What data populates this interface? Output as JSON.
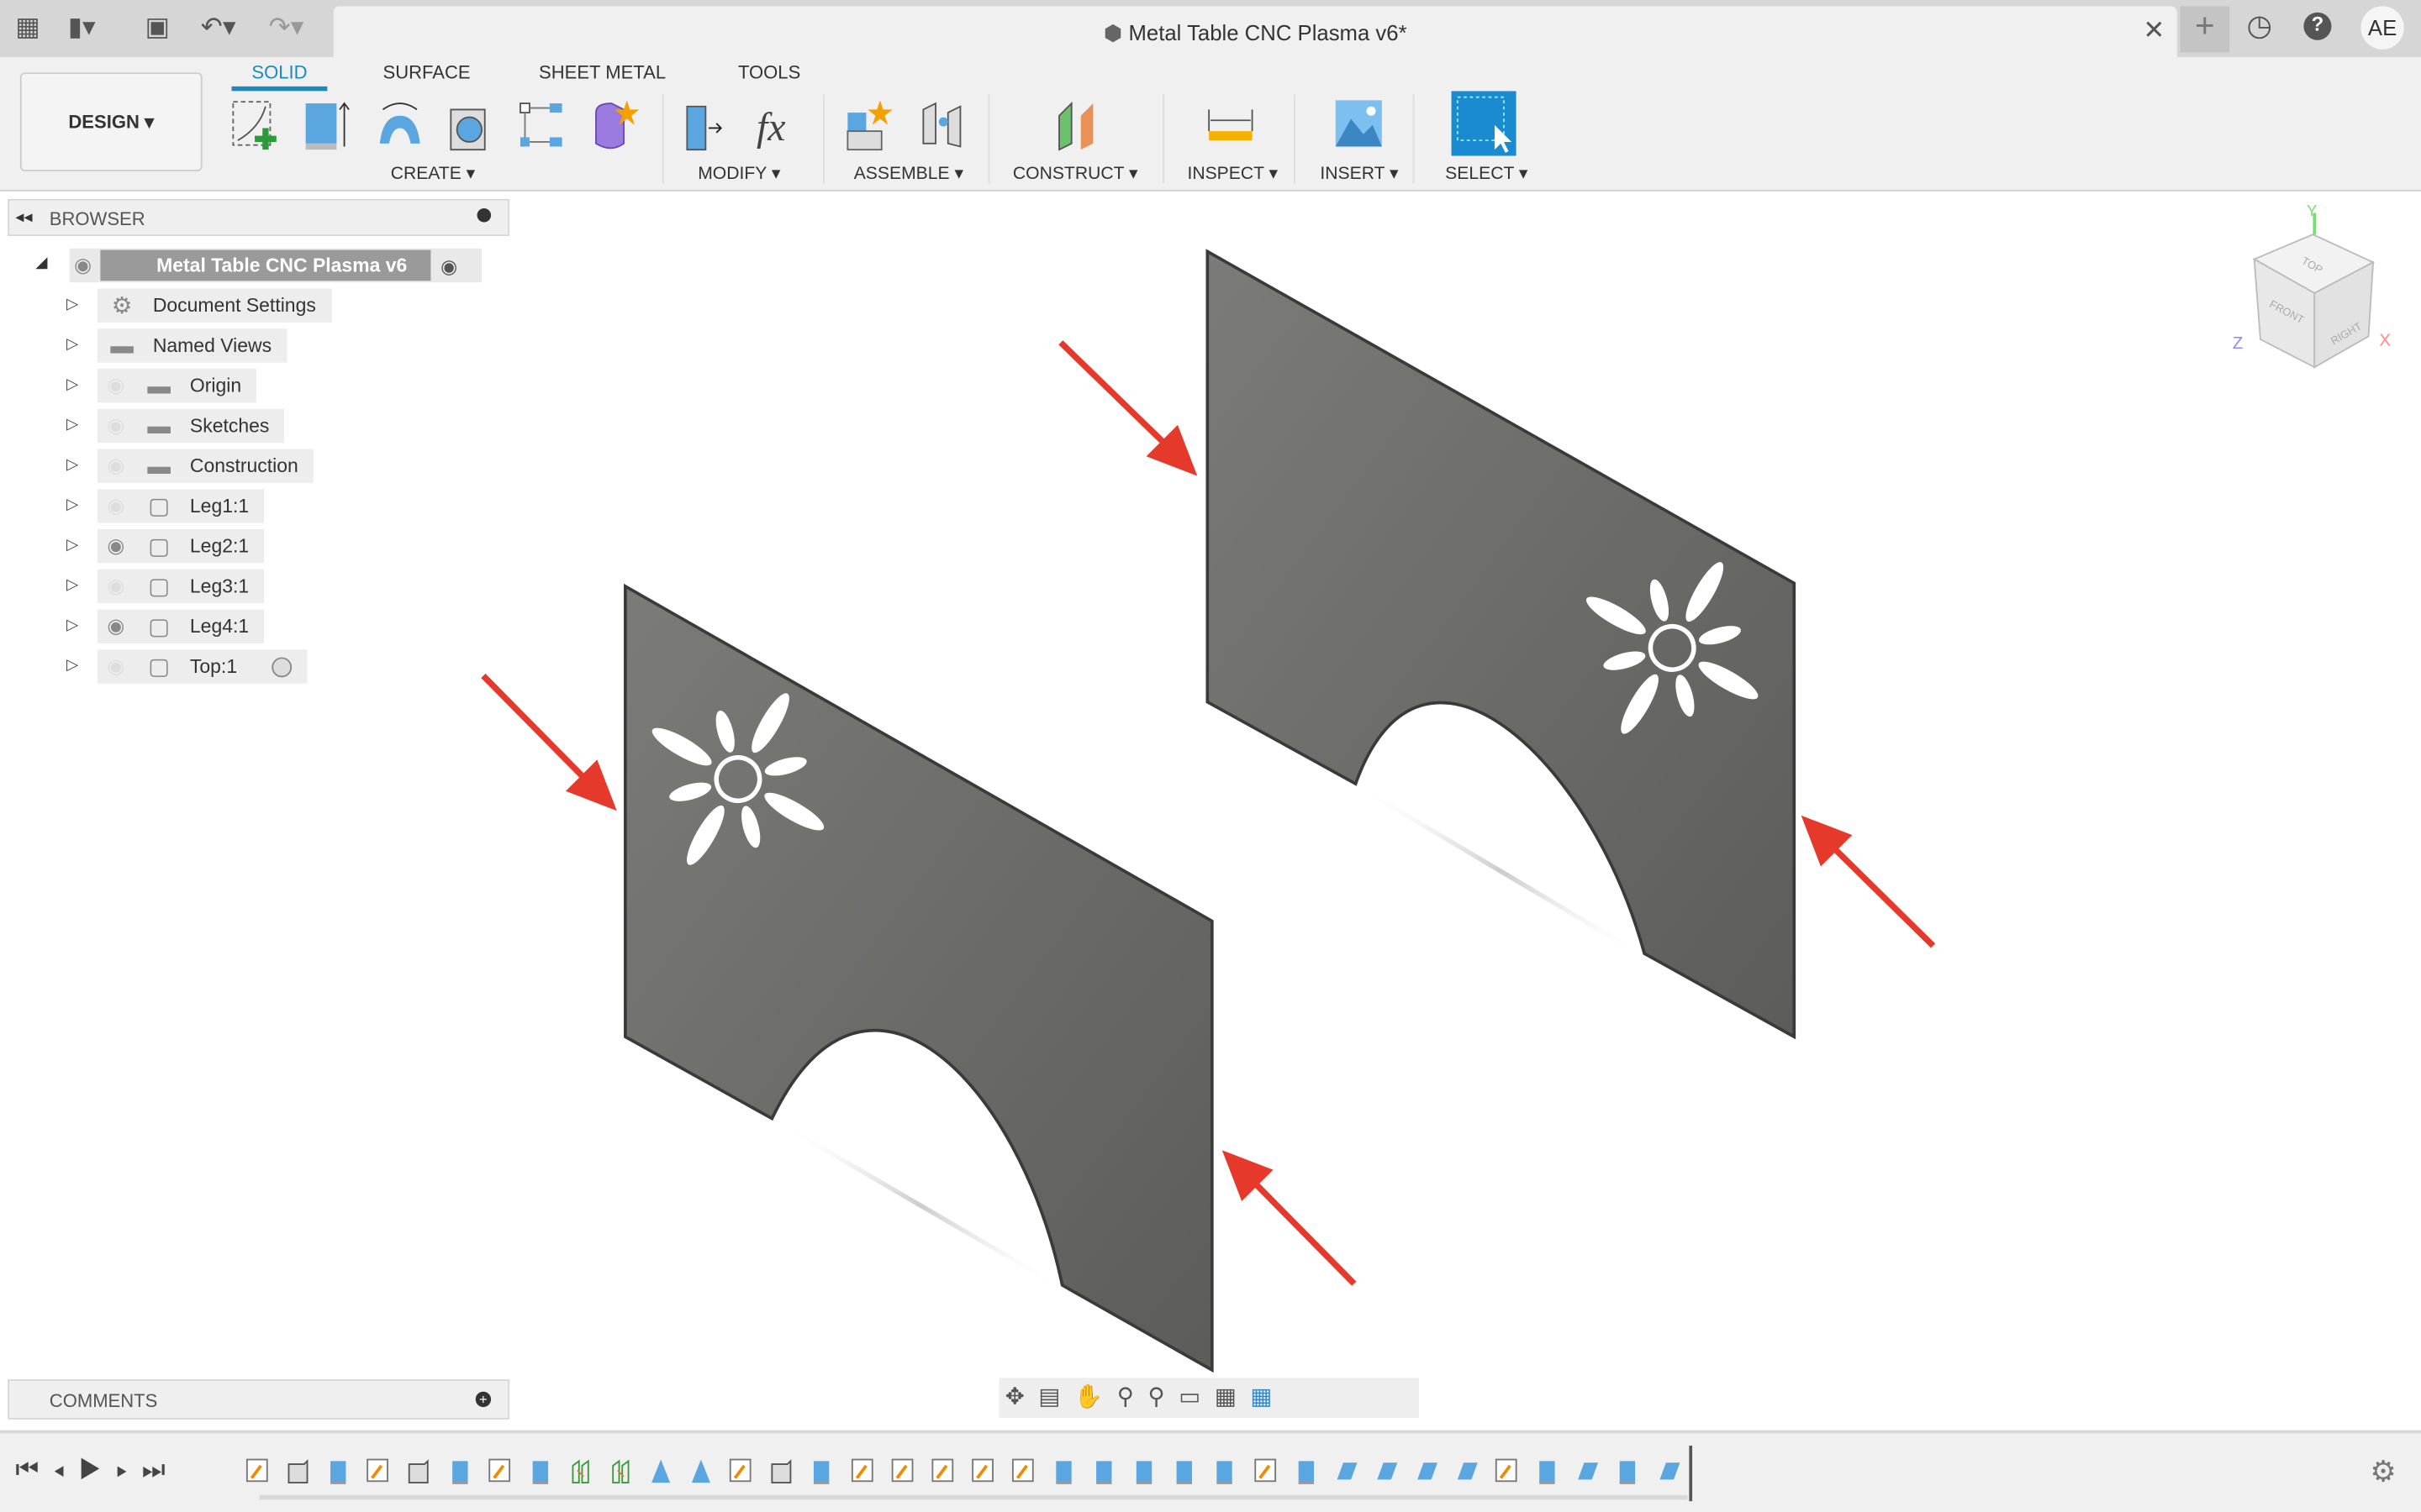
{
  "window": {
    "title": "Metal Table CNC Plasma v6*",
    "user_initials": "AE"
  },
  "titlebar_icons": [
    "app-grid-icon",
    "file-icon",
    "save-icon",
    "undo-icon",
    "redo-icon",
    "close-icon",
    "new-tab-icon",
    "clock-icon",
    "help-icon"
  ],
  "ribbon": {
    "workspace": "DESIGN ▾",
    "tabs": [
      {
        "label": "SOLID",
        "active": true
      },
      {
        "label": "SURFACE"
      },
      {
        "label": "SHEET METAL"
      },
      {
        "label": "TOOLS"
      }
    ],
    "groups": [
      {
        "label": "CREATE ▾",
        "tools": [
          "create-sketch-icon",
          "extrude-icon",
          "revolve-icon",
          "hole-icon",
          "rectangular-pattern-icon",
          "create-form-icon"
        ]
      },
      {
        "label": "MODIFY ▾",
        "tools": [
          "press-pull-icon",
          "parameters-fx-icon"
        ]
      },
      {
        "label": "ASSEMBLE ▾",
        "tools": [
          "new-component-icon",
          "joint-icon"
        ]
      },
      {
        "label": "CONSTRUCT ▾",
        "tools": [
          "offset-plane-icon"
        ]
      },
      {
        "label": "INSPECT ▾",
        "tools": [
          "measure-icon"
        ]
      },
      {
        "label": "INSERT ▾",
        "tools": [
          "insert-image-icon"
        ]
      },
      {
        "label": "SELECT ▾",
        "tools": [
          "select-icon"
        ]
      }
    ],
    "accent": "#1a8bc0"
  },
  "browser": {
    "title": "BROWSER",
    "root": "Metal Table CNC Plasma v6",
    "items": [
      {
        "label": "Document Settings",
        "icon": "gear-icon",
        "visible": null
      },
      {
        "label": "Named Views",
        "icon": "folder-icon",
        "visible": null
      },
      {
        "label": "Origin",
        "icon": "folder-icon",
        "visible": false
      },
      {
        "label": "Sketches",
        "icon": "folder-icon",
        "visible": false
      },
      {
        "label": "Construction",
        "icon": "folder-icon",
        "visible": false
      },
      {
        "label": "Leg1:1",
        "icon": "component-icon",
        "visible": false
      },
      {
        "label": "Leg2:1",
        "icon": "component-icon",
        "visible": true
      },
      {
        "label": "Leg3:1",
        "icon": "component-icon",
        "visible": false
      },
      {
        "label": "Leg4:1",
        "icon": "component-icon",
        "visible": true
      },
      {
        "label": "Top:1",
        "icon": "component-icon",
        "visible": false
      }
    ]
  },
  "comments": {
    "title": "COMMENTS"
  },
  "viewcube": {
    "top": "TOP",
    "front": "FRONT",
    "right": "RIGHT",
    "x": "X",
    "y": "Y",
    "z": "Z"
  },
  "navbar_icons": [
    "orbit-icon",
    "look-at-icon",
    "pan-icon",
    "zoom-icon",
    "fit-icon",
    "display-settings-icon",
    "grid-settings-icon",
    "viewports-icon"
  ],
  "timeline": {
    "controls": [
      "first-icon",
      "previous-icon",
      "play-icon",
      "next-icon",
      "last-icon"
    ],
    "features": [
      "sketch",
      "box",
      "extrude",
      "sketch",
      "box",
      "extrude",
      "sketch",
      "extrude",
      "joint",
      "joint",
      "plane",
      "plane",
      "sketch",
      "box",
      "extrude",
      "sketch",
      "sketch",
      "sketch",
      "sketch",
      "sketch",
      "extrude",
      "extrude",
      "extrude",
      "extrude",
      "extrude",
      "sketch",
      "extrude",
      "move",
      "move",
      "move",
      "move",
      "sketch",
      "extrude",
      "move",
      "extrude",
      "move"
    ]
  },
  "annotation_color": "#e53a2b"
}
